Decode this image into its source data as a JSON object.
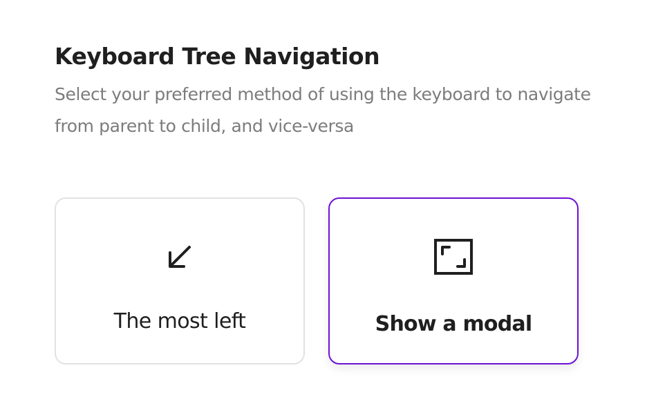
{
  "header": {
    "title": "Keyboard Tree Navigation",
    "description": "Select your preferred method of using the keyboard to navigate from parent to child, and vice-versa"
  },
  "options": [
    {
      "label": "The most left",
      "icon": "arrow-down-left-icon",
      "selected": false
    },
    {
      "label": "Show a modal",
      "icon": "expand-frame-icon",
      "selected": true
    }
  ],
  "colors": {
    "selected_border": "#6b12d6",
    "default_border": "#e2e2e2",
    "title": "#1f1f1f",
    "description": "#7c7c7c"
  }
}
